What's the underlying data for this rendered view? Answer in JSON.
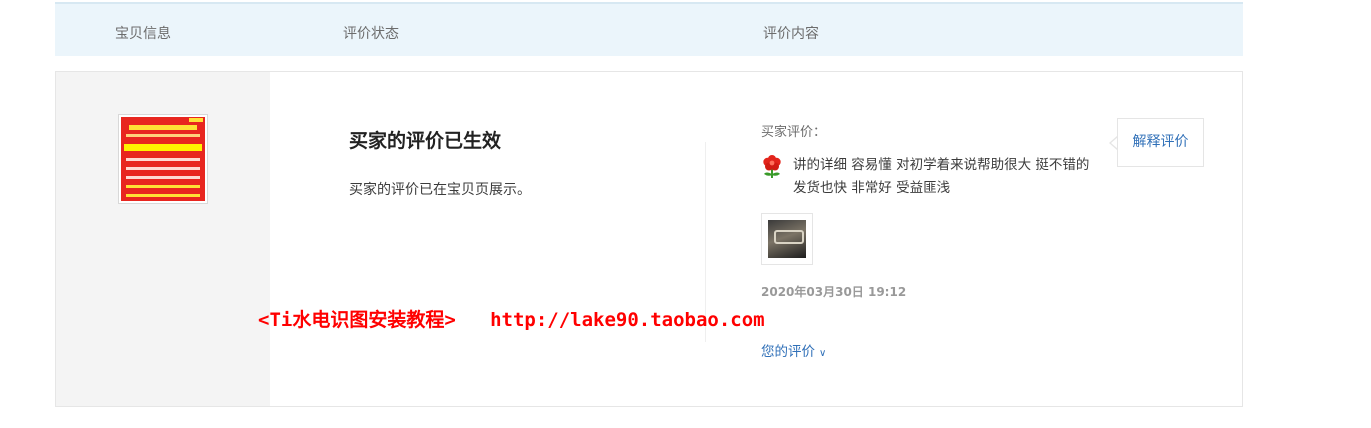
{
  "header": {
    "item_col": "宝贝信息",
    "status_col": "评价状态",
    "content_col": "评价内容"
  },
  "status": {
    "title": "买家的评价已生效",
    "description": "买家的评价已在宝贝页展示。"
  },
  "review": {
    "buyer_label": "买家评价：",
    "icon": "red-flower-icon",
    "text": "讲的详细 容易懂 对初学着来说帮助很大 挺不错的 发货也快 非常好 受益匪浅",
    "date": "2020年03月30日 19:12",
    "your_review_label": "您的评价",
    "explain_label": "解释评价"
  },
  "watermark": "<Ti水电识图安装教程>   http://lake90.taobao.com",
  "colors": {
    "header_bg": "#ebf5fb",
    "link": "#3070b8",
    "watermark": "#ff0000",
    "thumb_bg": "#e8261f"
  }
}
